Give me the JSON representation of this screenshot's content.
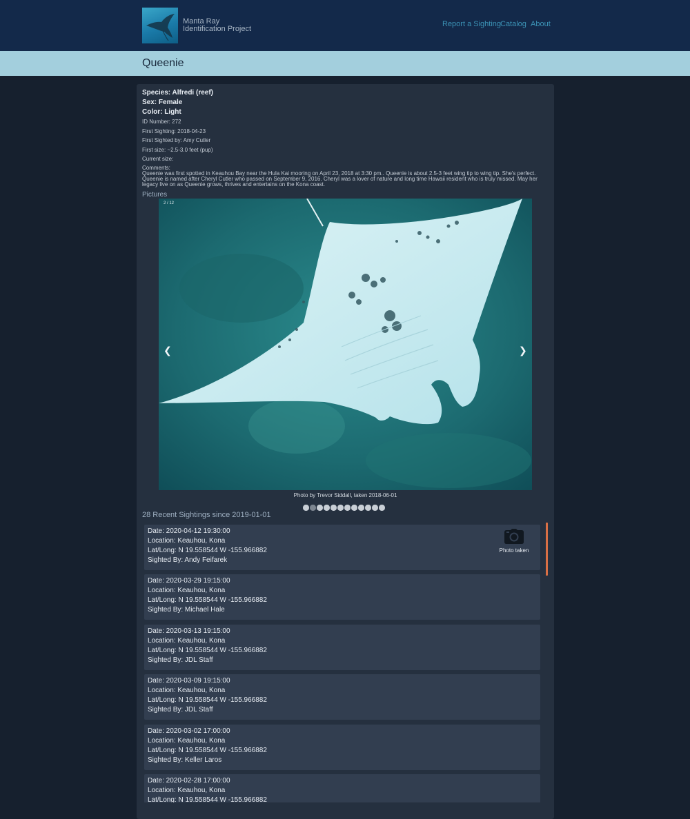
{
  "header": {
    "brand_line1": "Manta Ray",
    "brand_line2": "Identification Project",
    "nav": {
      "report": "Report a Sighting",
      "catalog": "Catalog",
      "about": "About"
    }
  },
  "page_title": "Queenie",
  "details": {
    "species": "Species: Alfredi (reef)",
    "sex": "Sex: Female",
    "color": "Color: Light",
    "id_number": "ID Number: 272",
    "first_sighting": "First Sighting: 2018-04-23",
    "first_sighted_by": "First Sighted by: Amy Cutler",
    "first_size": "First size: ~2.5-3.0 feet (pup)",
    "current_size": "Current size:",
    "comments_label": "Comments:",
    "comments_line1": "Queenie was first spotted in Keauhou Bay near the Hula Kai mooring on April 23, 2018 at 3:30 pm.. Queenie is about 2.5-3 feet wing tip to wing tip. She's perfect.",
    "comments_line2": "Queenie is named after Cheryl Cutler who passed on September 9, 2016. Cheryl was a lover of nature and long time Hawaii resident who is truly missed. May her",
    "comments_line3": "legacy live on as Queenie grows, thrives and entertains on the Kona coast."
  },
  "pictures": {
    "label": "Pictures",
    "counter": "2 / 12",
    "prev_glyph": "❮",
    "next_glyph": "❯",
    "caption": "Photo by Trevor Siddall, taken 2018-06-01",
    "total": 12,
    "active_index": 2
  },
  "sightings": {
    "heading": "28 Recent Sightings since 2019-01-01",
    "photo_taken_label": "Photo taken",
    "items": [
      {
        "date": "Date: 2020-04-12 19:30:00",
        "location": "Location: Keauhou, Kona",
        "latlong": "Lat/Long: N 19.558544 W -155.966882",
        "by": "Sighted By: Andy Feifarek",
        "photo": true
      },
      {
        "date": "Date: 2020-03-29 19:15:00",
        "location": "Location: Keauhou, Kona",
        "latlong": "Lat/Long: N 19.558544 W -155.966882",
        "by": "Sighted By: Michael Hale",
        "photo": false
      },
      {
        "date": "Date: 2020-03-13 19:15:00",
        "location": "Location: Keauhou, Kona",
        "latlong": "Lat/Long: N 19.558544 W -155.966882",
        "by": "Sighted By: JDL Staff",
        "photo": false
      },
      {
        "date": "Date: 2020-03-09 19:15:00",
        "location": "Location: Keauhou, Kona",
        "latlong": "Lat/Long: N 19.558544 W -155.966882",
        "by": "Sighted By: JDL Staff",
        "photo": false
      },
      {
        "date": "Date: 2020-03-02 17:00:00",
        "location": "Location: Keauhou, Kona",
        "latlong": "Lat/Long: N 19.558544 W -155.966882",
        "by": "Sighted By: Keller Laros",
        "photo": false
      },
      {
        "date": "Date: 2020-02-28 17:00:00",
        "location": "Location: Keauhou, Kona",
        "latlong": "Lat/Long: N 19.558544 W -155.966882",
        "by": "",
        "photo": false
      }
    ]
  },
  "icons": {
    "logo": "manta-ray-logo-icon",
    "camera": "camera-icon",
    "prev": "chevron-left-icon",
    "next": "chevron-right-icon"
  },
  "colors": {
    "header_bg": "#13294a",
    "title_band": "#a3cfdd",
    "nav_link": "#3c93b6",
    "card_bg": "#25303f",
    "item_bg": "#323e50",
    "scroll_accent": "#d96f45"
  }
}
